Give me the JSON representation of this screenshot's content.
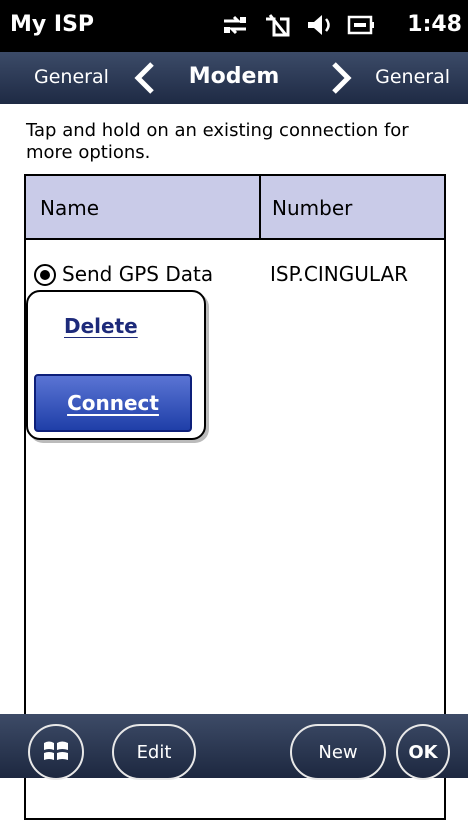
{
  "status_bar": {
    "app_title": "My ISP",
    "time": "1:48",
    "icons": [
      "connectivity-icon",
      "signal-off-icon",
      "speaker-icon",
      "battery-icon"
    ]
  },
  "nav": {
    "left": "General",
    "title": "Modem",
    "right": "General"
  },
  "instruction": "Tap and hold on an existing connection for more options.",
  "table": {
    "headers": {
      "name": "Name",
      "number": "Number"
    },
    "rows": [
      {
        "name": "Send GPS Data",
        "number": "ISP.CINGULAR"
      }
    ]
  },
  "context_menu": {
    "delete": "Delete",
    "connect": "Connect"
  },
  "bottom_bar": {
    "edit": "Edit",
    "new": "New",
    "ok": "OK"
  },
  "colors": {
    "header_bg": "#c9cbe8",
    "bar_bg": "#2a3550",
    "accent": "#1f3fa8"
  }
}
